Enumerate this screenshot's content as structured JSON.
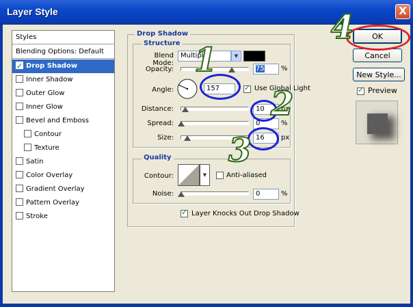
{
  "window": {
    "title": "Layer Style",
    "close_symbol": "X"
  },
  "styles_list": {
    "header": "Styles",
    "blending_options": "Blending Options: Default",
    "items": [
      {
        "label": "Drop Shadow",
        "checked": true,
        "selected": true
      },
      {
        "label": "Inner Shadow",
        "checked": false
      },
      {
        "label": "Outer Glow",
        "checked": false
      },
      {
        "label": "Inner Glow",
        "checked": false
      },
      {
        "label": "Bevel and Emboss",
        "checked": false
      },
      {
        "label": "Contour",
        "checked": false,
        "indent": true
      },
      {
        "label": "Texture",
        "checked": false,
        "indent": true
      },
      {
        "label": "Satin",
        "checked": false
      },
      {
        "label": "Color Overlay",
        "checked": false
      },
      {
        "label": "Gradient Overlay",
        "checked": false
      },
      {
        "label": "Pattern Overlay",
        "checked": false
      },
      {
        "label": "Stroke",
        "checked": false
      }
    ]
  },
  "drop_shadow": {
    "title": "Drop Shadow",
    "structure": {
      "title": "Structure",
      "blend_mode_label": "Blend Mode:",
      "blend_mode_value": "Multiply",
      "shadow_color": "#000000",
      "opacity_label": "Opacity:",
      "opacity_value": "75",
      "opacity_unit": "%",
      "angle_label": "Angle:",
      "angle_value": "157",
      "angle_unit": "°",
      "use_global_light_label": "Use Global Light",
      "use_global_light_checked": true,
      "distance_label": "Distance:",
      "distance_value": "10",
      "distance_unit": "px",
      "spread_label": "Spread:",
      "spread_value": "0",
      "spread_unit": "%",
      "size_label": "Size:",
      "size_value": "16",
      "size_unit": "px"
    },
    "quality": {
      "title": "Quality",
      "contour_label": "Contour:",
      "anti_aliased_label": "Anti-aliased",
      "anti_aliased_checked": false,
      "noise_label": "Noise:",
      "noise_value": "0",
      "noise_unit": "%"
    },
    "knockout_label": "Layer Knocks Out Drop Shadow",
    "knockout_checked": true
  },
  "buttons": {
    "ok": "OK",
    "cancel": "Cancel",
    "new_style": "New Style..."
  },
  "preview": {
    "label": "Preview",
    "checked": true
  },
  "annotations": {
    "n1": "1",
    "n2": "2",
    "n3": "3",
    "n4": "4"
  },
  "colors": {
    "title_bar": "#0a48c8",
    "selection": "#316ac5",
    "annotation_blue": "#1a21d8",
    "annotation_red": "#e0202a",
    "annotation_green": "#2f6b18"
  }
}
